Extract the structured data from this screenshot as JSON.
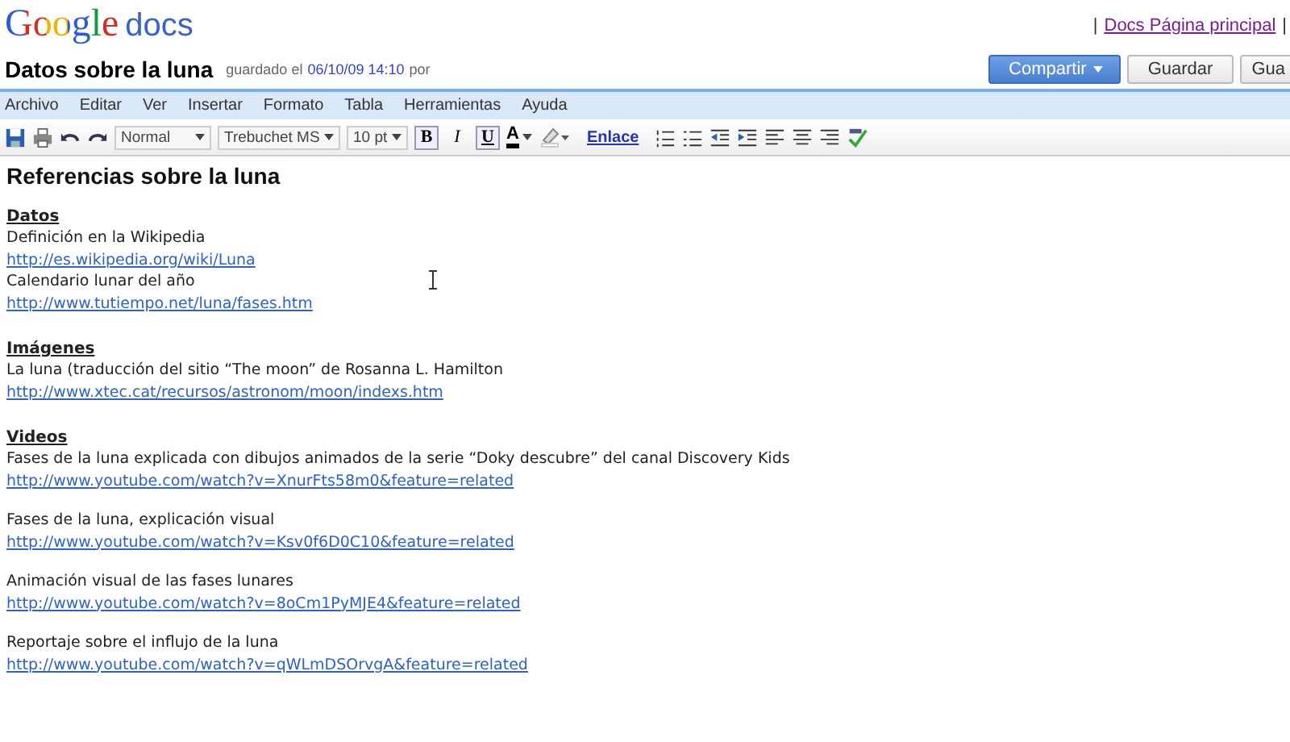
{
  "header": {
    "logo": "Google",
    "product": "docs",
    "links": [
      "|",
      "Docs Página principal",
      "|"
    ]
  },
  "document": {
    "title": "Datos sobre la luna",
    "saved_label": "guardado el",
    "saved_time": "06/10/09 14:10",
    "saved_by": "por"
  },
  "actions": [
    {
      "label": "Compartir",
      "kind": "primary",
      "caret": true
    },
    {
      "label": "Guardar",
      "kind": "normal",
      "caret": false
    },
    {
      "label": "Gua",
      "kind": "normal",
      "caret": false
    }
  ],
  "menu": [
    "Archivo",
    "Editar",
    "Ver",
    "Insertar",
    "Formato",
    "Tabla",
    "Herramientas",
    "Ayuda"
  ],
  "toolbar": {
    "style": "Normal",
    "font": "Trebuchet MS",
    "size": "10 pt",
    "format": [
      {
        "label": "B",
        "kind": "bold",
        "selected": true
      },
      {
        "label": "I",
        "kind": "italic",
        "selected": false
      },
      {
        "label": "U",
        "kind": "underline",
        "selected": true
      }
    ],
    "text_color": "A",
    "link": "Enlace"
  },
  "content": {
    "heading": "Referencias sobre la luna",
    "sections": [
      {
        "title": "Datos",
        "spaced": false,
        "entries": [
          {
            "text": "Definición en la Wikipedia",
            "url": "http://es.wikipedia.org/wiki/Luna"
          },
          {
            "text": "Calendario lunar del año",
            "url": "http://www.tutiempo.net/luna/fases.htm"
          }
        ]
      },
      {
        "title": "Imágenes",
        "spaced": false,
        "entries": [
          {
            "text": "La luna (traducción del sitio “The moon” de Rosanna L. Hamilton",
            "url": "http://www.xtec.cat/recursos/astronom/moon/indexs.htm"
          }
        ]
      },
      {
        "title": "Videos",
        "spaced": true,
        "entries": [
          {
            "text": "Fases de la luna explicada con dibujos animados de la serie “Doky descubre” del canal Discovery Kids",
            "url": "http://www.youtube.com/watch?v=XnurFts58m0&feature=related"
          },
          {
            "text": "Fases de la luna, explicación visual",
            "url": "http://www.youtube.com/watch?v=Ksv0f6D0C10&feature=related"
          },
          {
            "text": "Animación visual de las fases lunares",
            "url": "http://www.youtube.com/watch?v=8oCm1PyMJE4&feature=related"
          },
          {
            "text": "Reportaje sobre el influjo de la luna",
            "url": "http://www.youtube.com/watch?v=qWLmDSOrvgA&feature=related"
          }
        ]
      }
    ]
  }
}
